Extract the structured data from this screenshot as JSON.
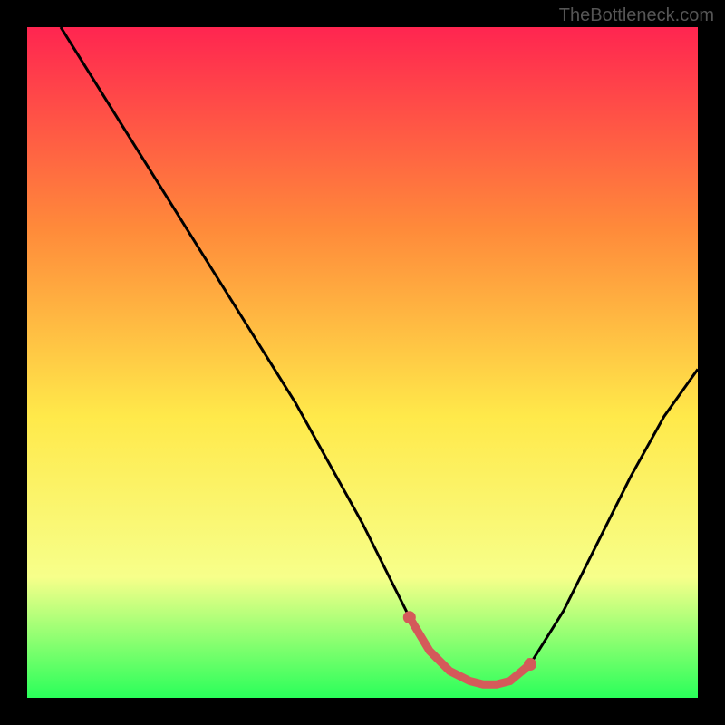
{
  "watermark": "TheBottleneck.com",
  "chart_data": {
    "type": "line",
    "title": "",
    "xlabel": "",
    "ylabel": "",
    "xlim": [
      0,
      100
    ],
    "ylim": [
      0,
      100
    ],
    "grid": false,
    "background_gradient": {
      "top": "#ff2550",
      "mid_upper": "#ff8a3a",
      "mid": "#ffe94a",
      "lower": "#f7ff8a",
      "bottom": "#2aff5a"
    },
    "series": [
      {
        "name": "bottleneck-curve",
        "color": "#000000",
        "x": [
          5,
          10,
          15,
          20,
          25,
          30,
          35,
          40,
          45,
          50,
          55,
          57,
          60,
          63,
          66,
          68,
          70,
          72,
          75,
          80,
          85,
          90,
          95,
          100
        ],
        "values": [
          100,
          92,
          84,
          76,
          68,
          60,
          52,
          44,
          35,
          26,
          16,
          12,
          7,
          4,
          2.5,
          2,
          2,
          2.5,
          5,
          13,
          23,
          33,
          42,
          49
        ]
      }
    ],
    "optimal_zone": {
      "color": "#d45a5a",
      "x": [
        57,
        60,
        63,
        66,
        68,
        70,
        72,
        75
      ],
      "values": [
        12,
        7,
        4,
        2.5,
        2,
        2,
        2.5,
        5
      ],
      "dots": [
        {
          "x": 57,
          "y": 12
        },
        {
          "x": 75,
          "y": 5
        }
      ]
    }
  }
}
